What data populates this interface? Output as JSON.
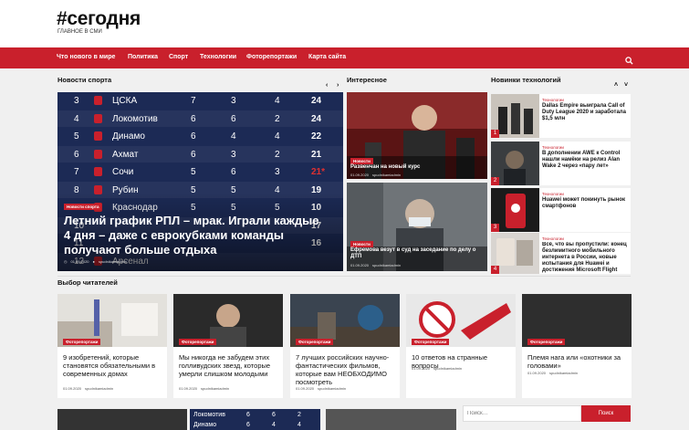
{
  "site": {
    "logo": "#сегодня",
    "tagline": "ГЛАВНОЕ В СМИ"
  },
  "nav": {
    "items": [
      "Что нового в мире",
      "Политика",
      "Спорт",
      "Технологии",
      "Фоторепортажи",
      "Карта сайта"
    ],
    "search_icon": "search-icon"
  },
  "sport": {
    "title": "Новости спорта",
    "prev": "‹",
    "next": "›",
    "table": [
      {
        "pos": "3",
        "team": "ЦСКА",
        "p": "7",
        "w": "3",
        "d": "4",
        "pts": "24"
      },
      {
        "pos": "4",
        "team": "Локомотив",
        "p": "6",
        "w": "6",
        "d": "2",
        "pts": "24"
      },
      {
        "pos": "5",
        "team": "Динамо",
        "p": "6",
        "w": "4",
        "d": "4",
        "pts": "22"
      },
      {
        "pos": "6",
        "team": "Ахмат",
        "p": "6",
        "w": "3",
        "d": "2",
        "pts": "21"
      },
      {
        "pos": "7",
        "team": "Сочи",
        "p": "5",
        "w": "6",
        "d": "3",
        "pts": "21*"
      },
      {
        "pos": "8",
        "team": "Рубин",
        "p": "5",
        "w": "5",
        "d": "4",
        "pts": "19"
      },
      {
        "pos": "9",
        "team": "Краснодар",
        "p": "5",
        "w": "5",
        "d": "5",
        "pts": "10"
      },
      {
        "pos": "10",
        "team": "",
        "p": "",
        "w": "",
        "d": "",
        "pts": "17"
      },
      {
        "pos": "11",
        "team": "",
        "p": "",
        "w": "",
        "d": "",
        "pts": "16"
      },
      {
        "pos": "12",
        "team": "Арсенал",
        "p": "",
        "w": "",
        "d": "",
        "pts": ""
      }
    ],
    "tag": "Новости спорта",
    "headline": "Летний график РПЛ – мрак. Играли каждые 4 дня – даже с еврокубками команды получают больше отдыха",
    "date": "01.09.2020",
    "author": "spudnikamiadmin"
  },
  "interesting": {
    "title": "Интересное",
    "items": [
      {
        "tag": "Новости",
        "title": "Развенчан на новый курс",
        "date": "01.09.2020",
        "author": "spudnikamiadmin"
      },
      {
        "tag": "Новости",
        "title": "Ефремова везут в суд на заседание по делу о ДТП",
        "date": "01.09.2020",
        "author": "spudnikamiadmin"
      }
    ]
  },
  "tech": {
    "title": "Новинки технологий",
    "prev": "˄",
    "next": "˅",
    "items": [
      {
        "num": "1",
        "tag": "Технологии",
        "title": "Dallas Empire выиграла Call of Duty League 2020 и заработала $1,5 млн"
      },
      {
        "num": "2",
        "tag": "Технологии",
        "title": "В дополнении AWE к Control нашли намёки на релиз Alan Wake 2 через «пару лет»"
      },
      {
        "num": "3",
        "tag": "Технологии",
        "title": "Huawei может покинуть рынок смартфонов"
      },
      {
        "num": "4",
        "tag": "Технологии",
        "title": "Всё, что вы пропустили: конец безлимитного мобильного интернета в России, новые испытания для Huawei и достижения Microsoft Flight Simulator"
      }
    ]
  },
  "readers": {
    "title": "Выбор читателей",
    "items": [
      {
        "tag": "Фоторепортажи",
        "title": "9 изобретений, которые становятся обязательными в современных домах",
        "date": "01.09.2020",
        "author": "spudnikamiadmin"
      },
      {
        "tag": "Фоторепортажи",
        "title": "Мы никогда не забудем этих голливудских звезд, которые умерли слишком молодыми",
        "date": "01.09.2020",
        "author": "spudnikamiadmin"
      },
      {
        "tag": "Фоторепортажи",
        "title": "7 лучших российских научно-фантастических фильмов, которые вам НЕОБХОДИМО посмотреть",
        "date": "01.09.2020",
        "author": "spudnikamiadmin"
      },
      {
        "tag": "Фоторепортажи",
        "title": "10 ответов на странные вопросы",
        "date": "01.09.2020",
        "author": "spudnikamiadmin"
      },
      {
        "tag": "Фоторепортажи",
        "title": "Племя нага или «охотники за головами»",
        "date": "01.09.2020",
        "author": "spudnikamiadmin"
      }
    ]
  },
  "bottom": {
    "table_rows": [
      {
        "team": "Локомотив",
        "p": "6",
        "w": "6",
        "d": "2"
      },
      {
        "team": "Динамо",
        "p": "6",
        "w": "4",
        "d": "4"
      }
    ]
  },
  "searchbox": {
    "placeholder": "Поиск…",
    "button": "Поиск"
  },
  "colors": {
    "accent": "#c9202c",
    "table_bg": "#1c2a55"
  }
}
